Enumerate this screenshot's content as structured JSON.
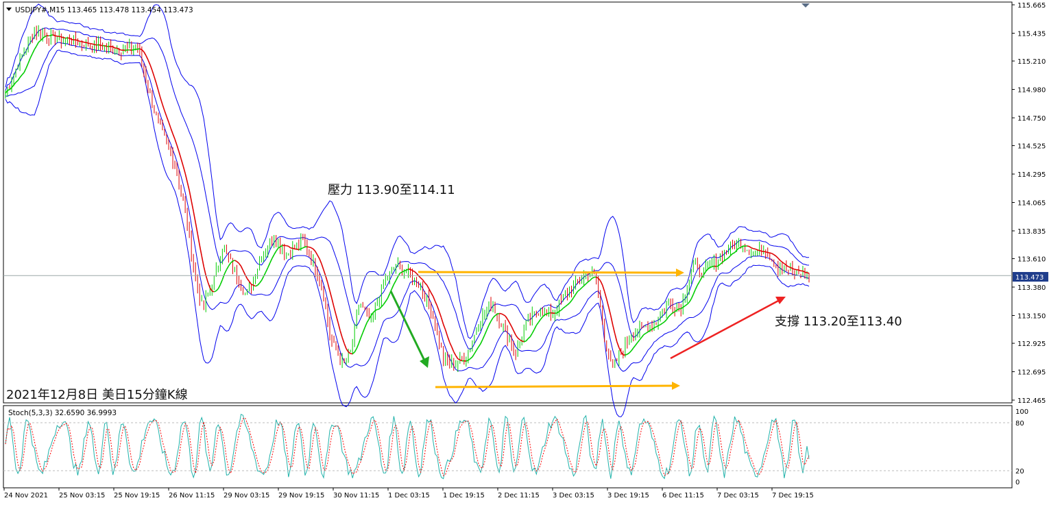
{
  "header": {
    "symbol_line": "USDJPY#,M15  113.465 113.478 113.454 113.473",
    "stoch_line": "Stoch(5,3,3) 32.6590 36.9993"
  },
  "annotations": {
    "resistance": "壓力 113.90至114.11",
    "support": "支撐 113.20至113.40",
    "caption": "2021年12月8日 美日15分鐘K線"
  },
  "colors": {
    "bands": "#0000ee",
    "bull_candle": "#00cc00",
    "bear_candle": "#dd0000",
    "current_price_line": "#9aa7a7",
    "current_price_label_bg": "#1f3d8c",
    "horizontal_arrows": "#ffb400",
    "down_arrow": "#22aa22",
    "up_arrow": "#ee2222",
    "stoch_main": "#20b2aa",
    "stoch_signal": "#ff0000"
  },
  "chart_data": [
    {
      "type": "candlestick",
      "symbol": "USDJPY#",
      "timeframe": "M15",
      "current_price": 113.473,
      "y_ticks": [
        "115.665",
        "115.435",
        "115.210",
        "114.980",
        "114.750",
        "114.525",
        "114.295",
        "114.065",
        "113.835",
        "113.610",
        "113.380",
        "113.150",
        "112.925",
        "112.695",
        "112.465"
      ],
      "current_price_label": "113.473",
      "ylim": [
        112.42,
        115.67
      ],
      "x_labels": [
        "24 Nov 2021",
        "25 Nov 03:15",
        "25 Nov 19:15",
        "26 Nov 11:15",
        "29 Nov 03:15",
        "29 Nov 19:15",
        "30 Nov 11:15",
        "1 Dec 03:15",
        "1 Dec 19:15",
        "2 Dec 11:15",
        "3 Dec 03:15",
        "3 Dec 19:15",
        "6 Dec 11:15",
        "7 Dec 03:15",
        "7 Dec 19:15"
      ],
      "overlays": [
        "price bands (blue)",
        "moving average (green/red)"
      ],
      "price_path": [
        [
          0,
          114.95
        ],
        [
          0.02,
          115.25
        ],
        [
          0.035,
          115.45
        ],
        [
          0.06,
          115.4
        ],
        [
          0.1,
          115.35
        ],
        [
          0.14,
          115.3
        ],
        [
          0.165,
          115.32
        ],
        [
          0.175,
          115.05
        ],
        [
          0.19,
          114.7
        ],
        [
          0.21,
          114.4
        ],
        [
          0.225,
          113.95
        ],
        [
          0.235,
          113.5
        ],
        [
          0.245,
          113.2
        ],
        [
          0.26,
          113.45
        ],
        [
          0.27,
          113.7
        ],
        [
          0.29,
          113.45
        ],
        [
          0.3,
          113.3
        ],
        [
          0.32,
          113.65
        ],
        [
          0.335,
          113.8
        ],
        [
          0.35,
          113.65
        ],
        [
          0.37,
          113.75
        ],
        [
          0.385,
          113.55
        ],
        [
          0.395,
          113.35
        ],
        [
          0.405,
          112.95
        ],
        [
          0.42,
          112.75
        ],
        [
          0.43,
          112.85
        ],
        [
          0.44,
          113.25
        ],
        [
          0.455,
          113.1
        ],
        [
          0.47,
          113.4
        ],
        [
          0.485,
          113.55
        ],
        [
          0.5,
          113.5
        ],
        [
          0.515,
          113.4
        ],
        [
          0.53,
          113.2
        ],
        [
          0.545,
          112.8
        ],
        [
          0.56,
          112.75
        ],
        [
          0.575,
          112.85
        ],
        [
          0.59,
          113.1
        ],
        [
          0.605,
          113.25
        ],
        [
          0.62,
          113.05
        ],
        [
          0.635,
          112.85
        ],
        [
          0.65,
          113.1
        ],
        [
          0.665,
          113.2
        ],
        [
          0.68,
          113.15
        ],
        [
          0.695,
          113.3
        ],
        [
          0.71,
          113.4
        ],
        [
          0.725,
          113.5
        ],
        [
          0.735,
          113.45
        ],
        [
          0.745,
          113.0
        ],
        [
          0.755,
          112.7
        ],
        [
          0.765,
          112.85
        ],
        [
          0.78,
          113.0
        ],
        [
          0.795,
          113.05
        ],
        [
          0.81,
          113.1
        ],
        [
          0.825,
          113.25
        ],
        [
          0.84,
          113.2
        ],
        [
          0.855,
          113.55
        ],
        [
          0.87,
          113.5
        ],
        [
          0.885,
          113.6
        ],
        [
          0.9,
          113.7
        ],
        [
          0.915,
          113.75
        ],
        [
          0.93,
          113.65
        ],
        [
          0.945,
          113.7
        ],
        [
          0.96,
          113.55
        ],
        [
          0.98,
          113.5
        ],
        [
          1.0,
          113.47
        ]
      ]
    },
    {
      "type": "line",
      "name": "Stoch(5,3,3)",
      "main_value": 32.659,
      "signal_value": 36.9993,
      "levels": [
        80,
        20
      ],
      "y_ticks": [
        "100",
        "80",
        "20",
        "0"
      ],
      "ylim": [
        0,
        100
      ]
    }
  ]
}
